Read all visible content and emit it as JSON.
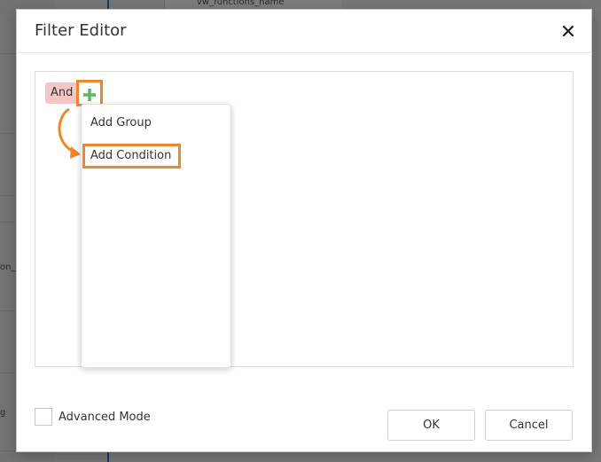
{
  "background": {
    "column_header": "vw_functions_name",
    "side_text_1": "on_",
    "side_text_2": "g"
  },
  "dialog": {
    "title": "Filter Editor",
    "close_icon": "close-icon"
  },
  "filter": {
    "group_operator": "And",
    "add_icon": "plus-icon",
    "menu": {
      "items": [
        "Add Group",
        "Add Condition"
      ]
    }
  },
  "footer": {
    "advanced_mode_label": "Advanced Mode",
    "advanced_mode_checked": false,
    "ok_label": "OK",
    "cancel_label": "Cancel"
  },
  "colors": {
    "highlight": "#f0862a",
    "plus": "#5cb85c",
    "group_operator_bg": "#f5c6c6"
  }
}
